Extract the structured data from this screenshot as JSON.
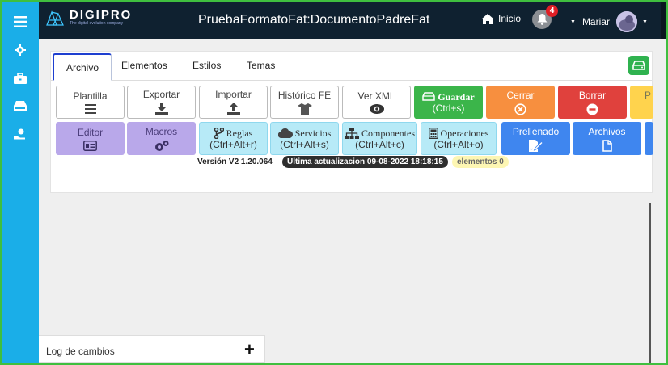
{
  "brand": {
    "name": "DIGIPRO",
    "tagline": "The digital evolution company"
  },
  "header": {
    "title": "PruebaFormatoFat:DocumentoPadreFat",
    "home_label": "Inicio",
    "notification_count": "4",
    "user_name": "Mariar"
  },
  "tabs": [
    {
      "label": "Archivo"
    },
    {
      "label": "Elementos"
    },
    {
      "label": "Estilos"
    },
    {
      "label": "Temas"
    }
  ],
  "toolbar_row1": {
    "plantilla": "Plantilla",
    "exportar": "Exportar",
    "importar": "Importar",
    "historico": "Histórico FE",
    "ver_xml": "Ver XML",
    "guardar": "Guardar",
    "guardar_shortcut": "(Ctrl+s)",
    "cerrar": "Cerrar",
    "borrar": "Borrar",
    "partial": "P"
  },
  "toolbar_row2": {
    "editor": "Editor",
    "macros": "Macros",
    "reglas": "Reglas",
    "reglas_shortcut": "(Ctrl+Alt+r)",
    "servicios": "Servicios",
    "servicios_shortcut": "(Ctrl+Alt+s)",
    "componentes": "Componentes",
    "componentes_shortcut": "(Ctrl+Alt+c)",
    "operaciones": "Operaciones",
    "operaciones_shortcut": "(Ctrl+Alt+o)",
    "prellenado": "Prellenado",
    "archivos": "Archivos"
  },
  "status": {
    "version": "Versión V2 1.20.064",
    "updated": "Ultima actualizacion 09-08-2022 18:18:15",
    "elements": "elementos 0"
  },
  "log": {
    "title": "Log de cambios"
  },
  "colors": {
    "sidebar": "#1aaee8",
    "topbar": "#0f2130",
    "accent_tab": "#1e3fd0",
    "green": "#3bb54a",
    "orange": "#f78f3f",
    "red": "#e0413d",
    "purple": "#b9a8ea",
    "cyan": "#b7eaf7",
    "blue": "#3f86ef"
  }
}
